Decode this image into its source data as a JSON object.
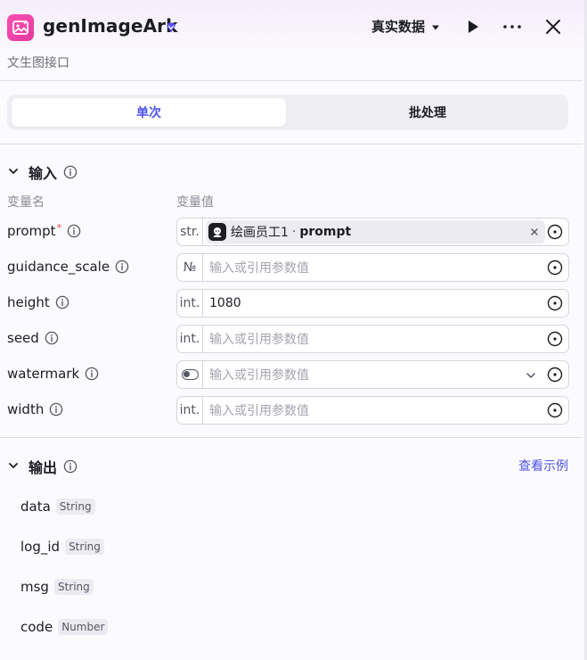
{
  "header": {
    "title": "genImageArk",
    "subtitle": "文生图接口",
    "data_mode": "真实数据"
  },
  "mode_tabs": {
    "single": "单次",
    "batch": "批处理",
    "selected": "single"
  },
  "input_section": {
    "title": "输入",
    "col_name": "变量名",
    "col_value": "变量值",
    "placeholder": "输入或引用参数值",
    "params": [
      {
        "name": "prompt",
        "required_mark": "*",
        "type_tag": "str.",
        "ref_node": "绘画员工1",
        "ref_sep": "·",
        "ref_var": "prompt"
      },
      {
        "name": "guidance_scale",
        "type_tag": "№",
        "value": ""
      },
      {
        "name": "height",
        "type_tag": "int.",
        "value": "1080"
      },
      {
        "name": "seed",
        "type_tag": "int.",
        "value": ""
      },
      {
        "name": "watermark",
        "type_tag": "toggle",
        "value": ""
      },
      {
        "name": "width",
        "type_tag": "int.",
        "value": ""
      }
    ]
  },
  "output_section": {
    "title": "输出",
    "view_example": "查看示例",
    "fields": [
      {
        "name": "data",
        "type": "String"
      },
      {
        "name": "log_id",
        "type": "String"
      },
      {
        "name": "msg",
        "type": "String"
      },
      {
        "name": "code",
        "type": "Number"
      }
    ]
  },
  "colors": {
    "accent": "#4d53e8",
    "app_icon": "#e23aa0",
    "required": "#e5484d",
    "verified_badge": "#5b4df0"
  },
  "icons": {
    "app": "image-generate-icon",
    "verified": "diamond-badge-icon",
    "run": "play-icon",
    "more": "more-horizontal-icon",
    "close": "close-icon",
    "info": "info-circle-icon",
    "target": "variable-target-icon"
  }
}
